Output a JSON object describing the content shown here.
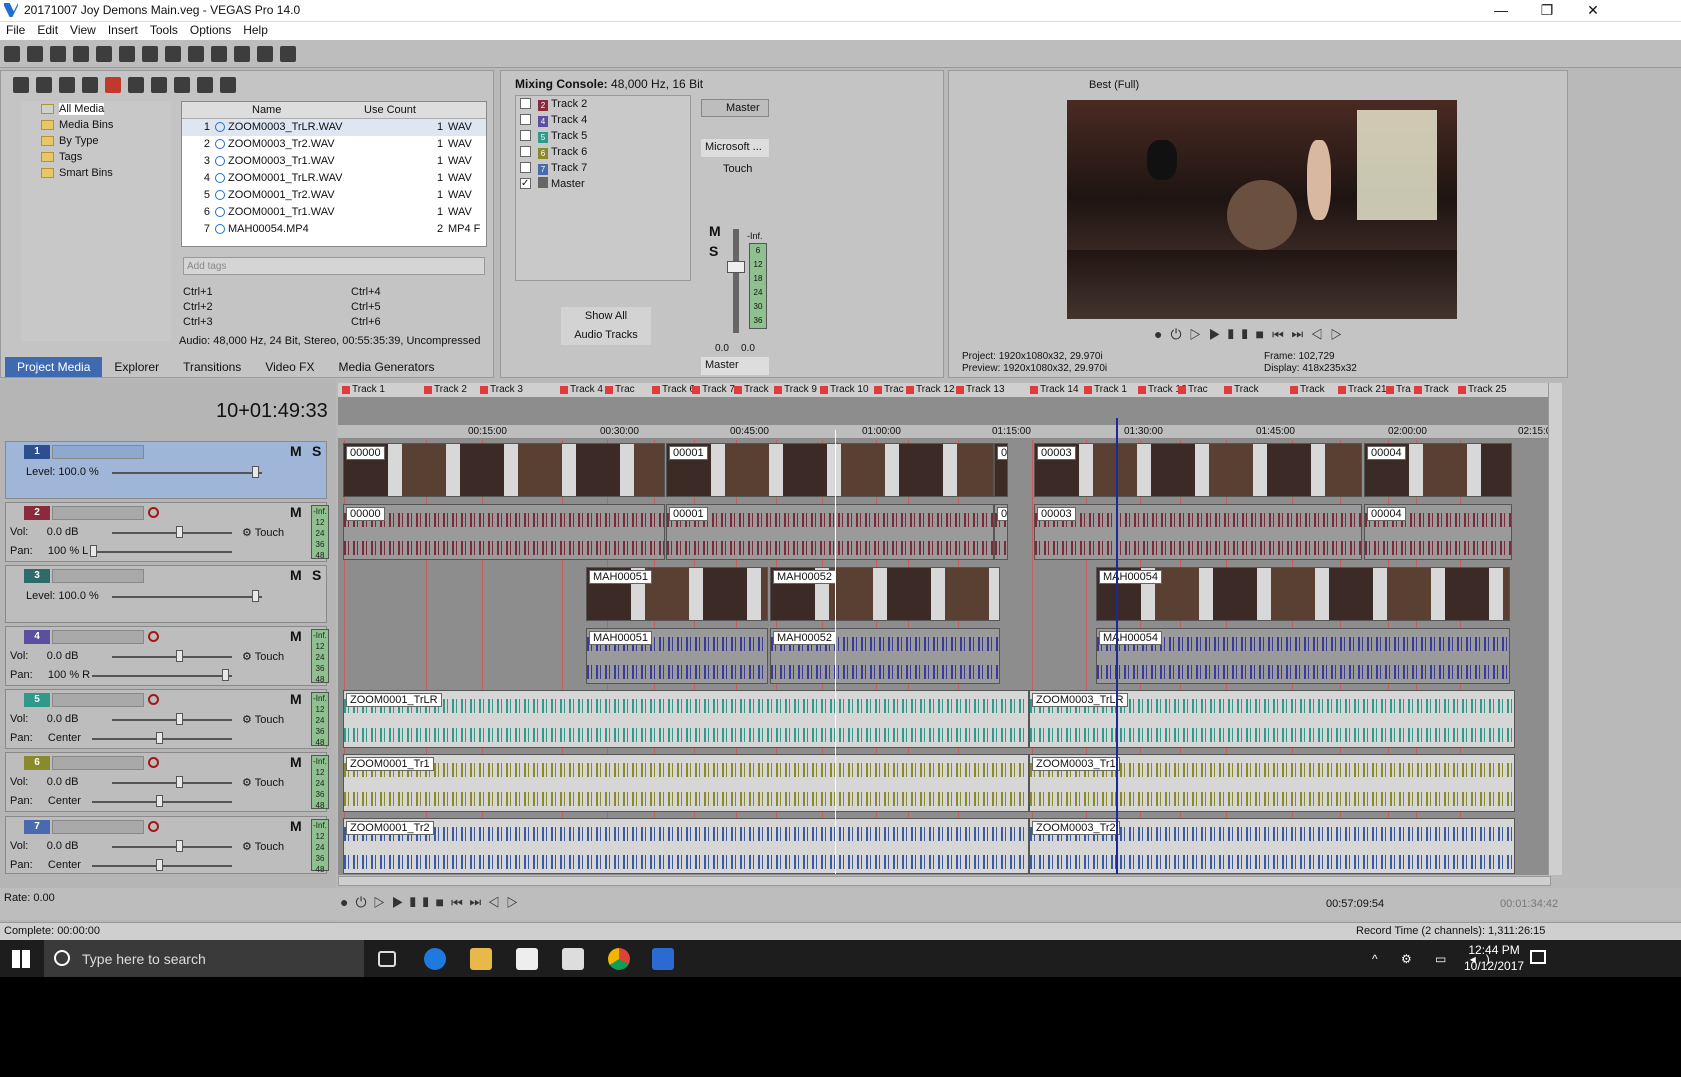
{
  "window": {
    "title": "20171007 Joy Demons Main.veg - VEGAS Pro 14.0",
    "minimize": "—",
    "maximize": "❐",
    "close": "✕"
  },
  "menu": [
    "File",
    "Edit",
    "View",
    "Insert",
    "Tools",
    "Options",
    "Help"
  ],
  "media": {
    "tree": [
      "All Media",
      "Media Bins",
      "By Type",
      "Tags",
      "Smart Bins"
    ],
    "columns": {
      "name": "Name",
      "use_count": "Use Count"
    },
    "rows": [
      {
        "n": "1",
        "name": "ZOOM0003_TrLR.WAV",
        "count": "1",
        "type": "WAV"
      },
      {
        "n": "2",
        "name": "ZOOM0003_Tr2.WAV",
        "count": "1",
        "type": "WAV"
      },
      {
        "n": "3",
        "name": "ZOOM0003_Tr1.WAV",
        "count": "1",
        "type": "WAV"
      },
      {
        "n": "4",
        "name": "ZOOM0001_TrLR.WAV",
        "count": "1",
        "type": "WAV"
      },
      {
        "n": "5",
        "name": "ZOOM0001_Tr2.WAV",
        "count": "1",
        "type": "WAV"
      },
      {
        "n": "6",
        "name": "ZOOM0001_Tr1.WAV",
        "count": "1",
        "type": "WAV"
      },
      {
        "n": "7",
        "name": "MAH00054.MP4",
        "count": "2",
        "type": "MP4 F"
      }
    ],
    "tags_placeholder": "Add tags",
    "shortcuts": [
      "Ctrl+1",
      "Ctrl+4",
      "Ctrl+2",
      "Ctrl+5",
      "Ctrl+3",
      "Ctrl+6"
    ],
    "info": "Audio: 48,000 Hz, 24 Bit, Stereo, 00:55:35:39, Uncompressed",
    "tabs": [
      "Project Media",
      "Explorer",
      "Transitions",
      "Video FX",
      "Media Generators"
    ]
  },
  "mixer": {
    "title": "Mixing Console:",
    "format": "48,000 Hz, 16 Bit",
    "tracks": [
      {
        "num": "2",
        "name": "Track 2",
        "color": "#8a2a3a"
      },
      {
        "num": "4",
        "name": "Track 4",
        "color": "#5a4fa0"
      },
      {
        "num": "5",
        "name": "Track 5",
        "color": "#2f9a8a"
      },
      {
        "num": "6",
        "name": "Track 6",
        "color": "#8a8a2a"
      },
      {
        "num": "7",
        "name": "Track 7",
        "color": "#4a6ab0"
      },
      {
        "num": "",
        "name": "Master",
        "color": "#666"
      }
    ],
    "show_all": "Show All",
    "audio_tracks": "Audio Tracks",
    "master": "Master",
    "device": "Microsoft ...",
    "touch": "Touch",
    "inf": "-Inf.",
    "scale": [
      "6",
      "12",
      "18",
      "24",
      "30",
      "36"
    ],
    "val_l": "0.0",
    "val_r": "0.0",
    "master_bottom": "Master"
  },
  "preview": {
    "quality": "Best (Full)",
    "project_label": "Project:",
    "project": "1920x1080x32, 29.970i",
    "preview_label": "Preview:",
    "preview_val": "1920x1080x32, 29.970i",
    "frame_label": "Frame:",
    "frame": "102,729",
    "display_label": "Display:",
    "display": "418x235x32"
  },
  "timeline": {
    "timecode": "10+01:49:33",
    "markers": [
      "Track 1",
      "Track 2",
      "Track 3",
      "Track 4",
      "Trac",
      "Track 6",
      "Track 7",
      "Track",
      "Track 9",
      "Track 10",
      "Trac",
      "Track 12",
      "Track 13",
      "Track 14",
      "Track 1",
      "Track 16",
      "Trac",
      "Track",
      "Track",
      "Track 21",
      "Tra",
      "Track",
      "Track 25"
    ],
    "ticks": [
      "00:15:00",
      "00:30:00",
      "00:45:00",
      "01:00:00",
      "01:15:00",
      "01:30:00",
      "01:45:00",
      "02:00:00",
      "02:15:0"
    ],
    "tracks": [
      {
        "num": "1",
        "type": "video",
        "color": "#2e4f8f",
        "level_label": "Level:",
        "level": "100.0 %"
      },
      {
        "num": "2",
        "type": "audio",
        "color": "#8a2a3a",
        "vol_label": "Vol:",
        "vol": "0.0 dB",
        "pan_label": "Pan:",
        "pan": "100 % L",
        "touch": "Touch"
      },
      {
        "num": "3",
        "type": "video",
        "color": "#2f6a6a",
        "level_label": "Level:",
        "level": "100.0 %"
      },
      {
        "num": "4",
        "type": "audio",
        "color": "#5a4fa0",
        "vol_label": "Vol:",
        "vol": "0.0 dB",
        "pan_label": "Pan:",
        "pan": "100 % R",
        "touch": "Touch"
      },
      {
        "num": "5",
        "type": "audio",
        "color": "#2f9a8a",
        "vol_label": "Vol:",
        "vol": "0.0 dB",
        "pan_label": "Pan:",
        "pan": "Center",
        "touch": "Touch"
      },
      {
        "num": "6",
        "type": "audio",
        "color": "#8a8a2a",
        "vol_label": "Vol:",
        "vol": "0.0 dB",
        "pan_label": "Pan:",
        "pan": "Center",
        "touch": "Touch"
      },
      {
        "num": "7",
        "type": "audio",
        "color": "#4a6ab0",
        "vol_label": "Vol:",
        "vol": "0.0 dB",
        "pan_label": "Pan:",
        "pan": "Center",
        "touch": "Touch"
      }
    ],
    "meter_inf": "-Inf.",
    "meter_vals": [
      "12",
      "24",
      "36",
      "48"
    ],
    "clips": {
      "v1": [
        "00000",
        "00001",
        "00",
        "00003",
        "00004"
      ],
      "a2": [
        "00000",
        "00001",
        "00",
        "00003",
        "00004"
      ],
      "v3": [
        "MAH00051",
        "MAH00052",
        "MAH00054"
      ],
      "a4": [
        "MAH00051",
        "MAH00052",
        "MAH00054"
      ],
      "a5": [
        "ZOOM0001_TrLR",
        "ZOOM0003_TrLR"
      ],
      "a6": [
        "ZOOM0001_Tr1",
        "ZOOM0003_Tr1"
      ],
      "a7": [
        "ZOOM0001_Tr2",
        "ZOOM0003_Tr2"
      ]
    },
    "rate": "Rate: 0.00",
    "cursor_time": "00:57:09:54",
    "end_time": "00:01:34:42",
    "record_time": "Record Time (2 channels): 1,311:26:15"
  },
  "status": {
    "complete": "Complete: 00:00:00"
  },
  "taskbar": {
    "search": "Type here to search",
    "time": "12:44 PM",
    "date": "10/12/2017"
  }
}
